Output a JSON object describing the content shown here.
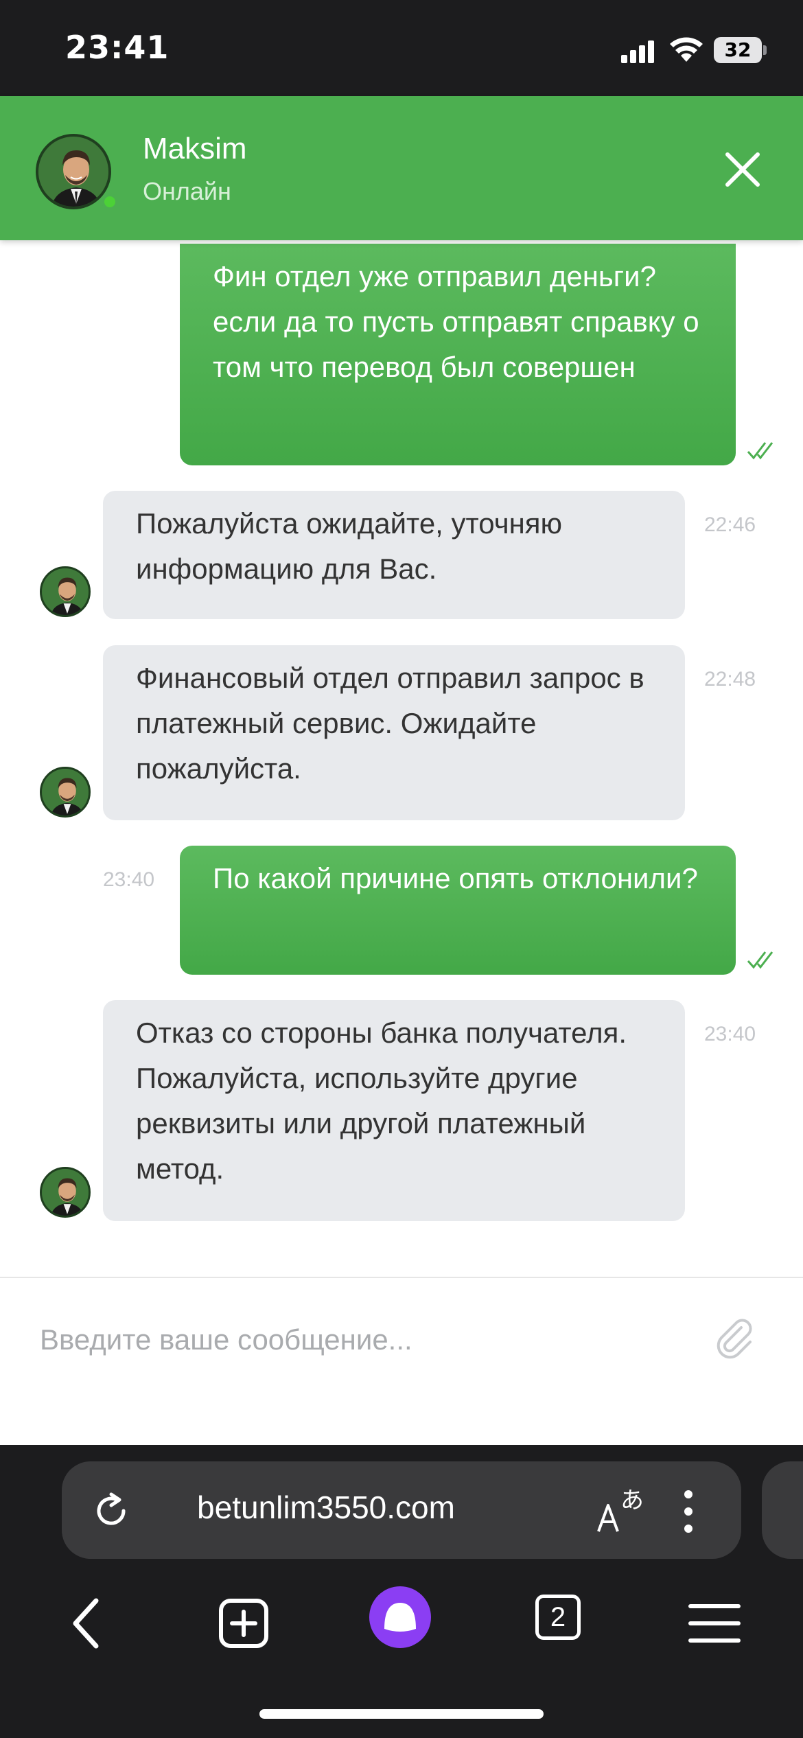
{
  "status_bar": {
    "time": "23:41",
    "battery": "32"
  },
  "header": {
    "name": "Maksim",
    "status": "Онлайн",
    "accent": "#4caf50"
  },
  "messages": [
    {
      "direction": "outgoing",
      "text": "Фин отдел уже отправил деньги?если да то пусть отправят справку о том что перевод был совершен",
      "time": "",
      "read": true
    },
    {
      "direction": "incoming",
      "text": "Пожалуйста ожидайте, уточняю информацию для Вас.",
      "time": "22:46"
    },
    {
      "direction": "incoming",
      "text": "Финансовый отдел отправил запрос в платежный сервис. Ожидайте пожалуйста.",
      "time": "22:48"
    },
    {
      "direction": "outgoing",
      "text": "По какой причине опять отклонили?",
      "time": "23:40",
      "read": true
    },
    {
      "direction": "incoming",
      "text": "Отказ со стороны банка получателя. Пожалуйста, используйте другие реквизиты или другой платежный метод.",
      "time": "23:40"
    }
  ],
  "composer": {
    "placeholder": "Введите ваше сообщение..."
  },
  "browser": {
    "url": "betunlim3550.com",
    "tab_count": "2"
  }
}
